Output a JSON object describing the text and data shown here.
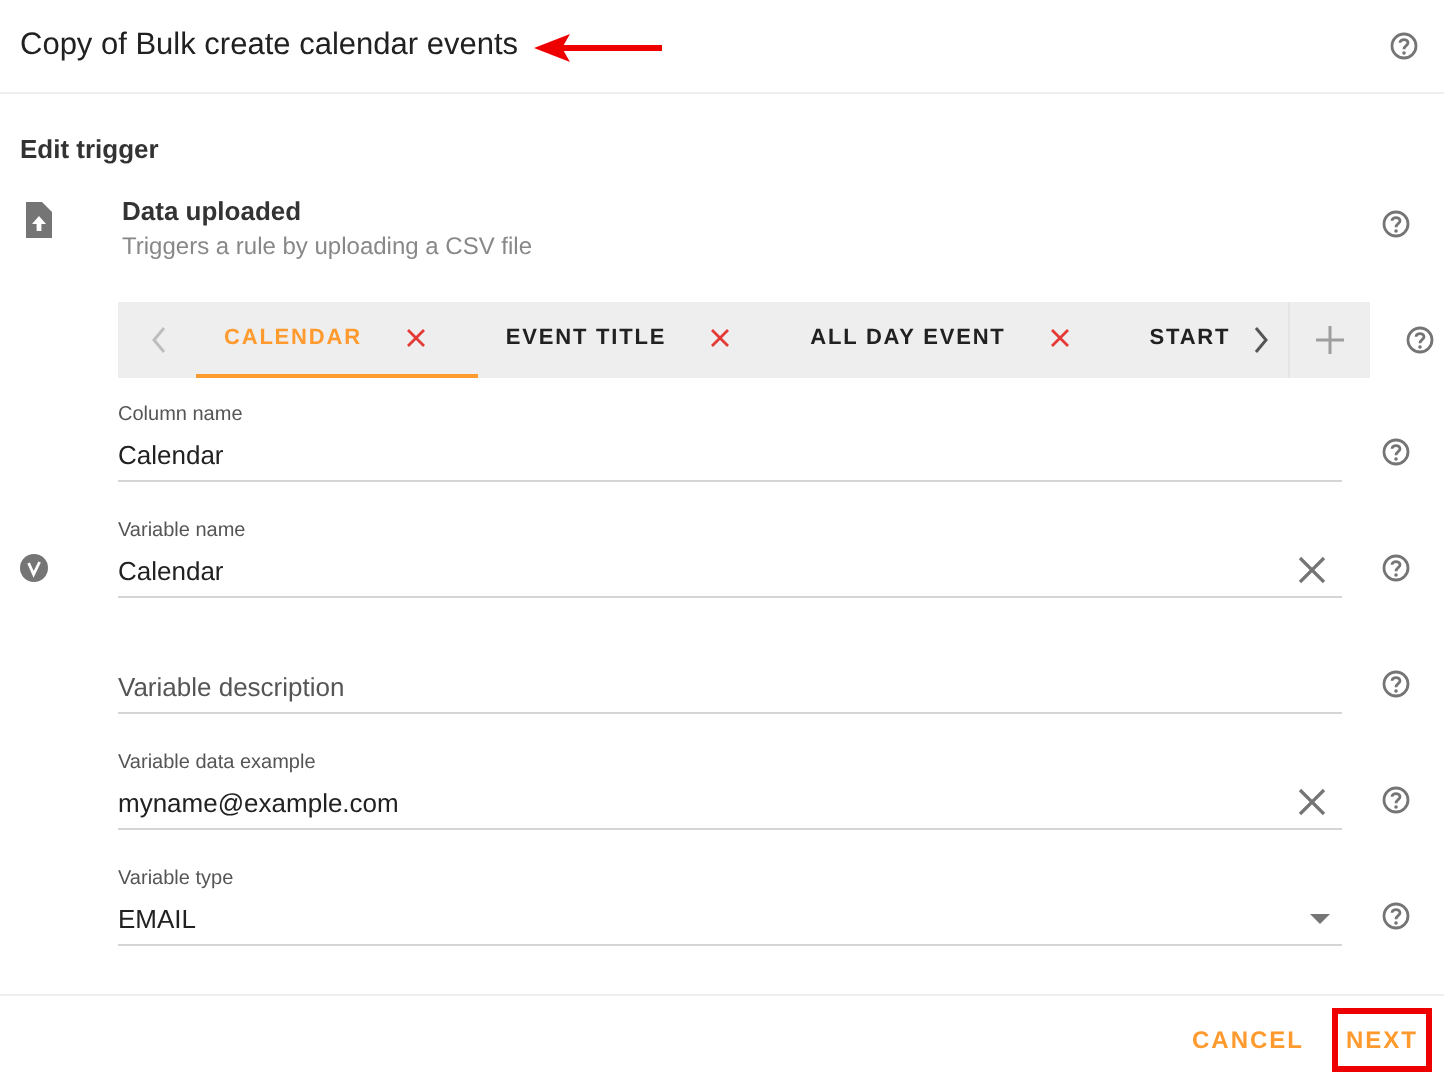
{
  "header": {
    "title": "Copy of Bulk create calendar events",
    "title_arrow": true
  },
  "section_title": "Edit trigger",
  "trigger": {
    "name": "Data uploaded",
    "description": "Triggers a rule by uploading a CSV file"
  },
  "tabs": [
    {
      "label": "CALENDAR",
      "selected": true,
      "closable": true
    },
    {
      "label": "EVENT TITLE",
      "selected": false,
      "closable": true
    },
    {
      "label": "ALL DAY EVENT",
      "selected": false,
      "closable": true
    },
    {
      "label": "START",
      "selected": false,
      "closable": false
    }
  ],
  "fields": [
    {
      "kind": "text",
      "label": "Column name",
      "value": "Calendar",
      "clearable": false,
      "variable_icon": false
    },
    {
      "kind": "text",
      "label": "Variable name",
      "value": "Calendar",
      "clearable": true,
      "variable_icon": true
    },
    {
      "kind": "text",
      "placeholder": "Variable description",
      "clearable": false,
      "variable_icon": false
    },
    {
      "kind": "text",
      "label": "Variable data example",
      "value": "myname@example.com",
      "clearable": true,
      "variable_icon": false
    },
    {
      "kind": "select",
      "label": "Variable type",
      "value": "EMAIL",
      "clearable": false,
      "variable_icon": false
    }
  ],
  "buttons": [
    {
      "label": "CANCEL",
      "highlighted": false
    },
    {
      "label": "NEXT",
      "highlighted": true
    }
  ]
}
